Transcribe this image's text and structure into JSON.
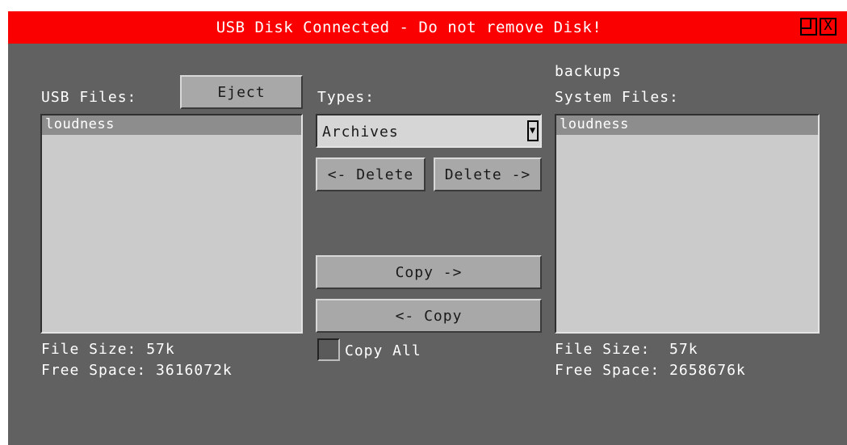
{
  "window": {
    "title": "USB Disk Connected - Do not remove Disk!",
    "maximize_icon": "maximize-icon",
    "close_icon": "close-icon",
    "close_glyph": "X",
    "colors": {
      "titlebar": "#fb0000",
      "background": "#616161",
      "list": "#cbcbcb",
      "selected": "#8d8d8d"
    }
  },
  "usb": {
    "label": "USB Files:",
    "eject_label": "Eject",
    "files": [
      "loudness"
    ],
    "file_size": "File Size: 57k",
    "free_space": "Free Space: 3616072k"
  },
  "middle": {
    "types_label": "Types:",
    "types_selected": "Archives",
    "delete_left_label": "<- Delete",
    "delete_right_label": "Delete ->",
    "copy_right_label": "Copy ->",
    "copy_left_label": "<- Copy",
    "copy_all_label": "Copy All",
    "copy_all_checked": false
  },
  "system": {
    "folder": "backups",
    "label": "System Files:",
    "files": [
      "loudness"
    ],
    "file_size": "File Size:  57k",
    "free_space": "Free Space: 2658676k"
  }
}
